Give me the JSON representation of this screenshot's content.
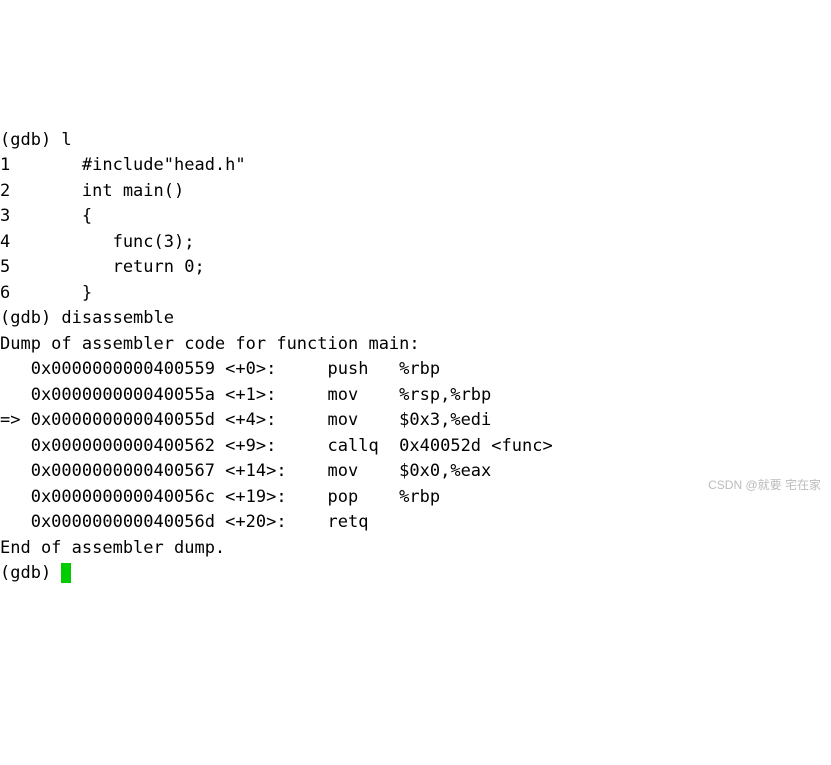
{
  "prompt1": "(gdb) l",
  "src": {
    "l1": "1       #include\"head.h\"",
    "l2": "2       int main()",
    "l3": "3       {",
    "l4": "4          func(3);",
    "l5": "5          return 0;",
    "l6": "6       }"
  },
  "prompt2": "(gdb) disassemble",
  "dump_header": "Dump of assembler code for function main:",
  "asm": {
    "a1": "   0x0000000000400559 <+0>:     push   %rbp",
    "a2": "   0x000000000040055a <+1>:     mov    %rsp,%rbp",
    "a3": "=> 0x000000000040055d <+4>:     mov    $0x3,%edi",
    "a4": "   0x0000000000400562 <+9>:     callq  0x40052d <func>",
    "a5": "   0x0000000000400567 <+14>:    mov    $0x0,%eax",
    "a6": "   0x000000000040056c <+19>:    pop    %rbp",
    "a7": "   0x000000000040056d <+20>:    retq",
    "end": "End of assembler dump."
  },
  "prompt3": "(gdb) ",
  "watermark": "CSDN @就要 宅在家"
}
